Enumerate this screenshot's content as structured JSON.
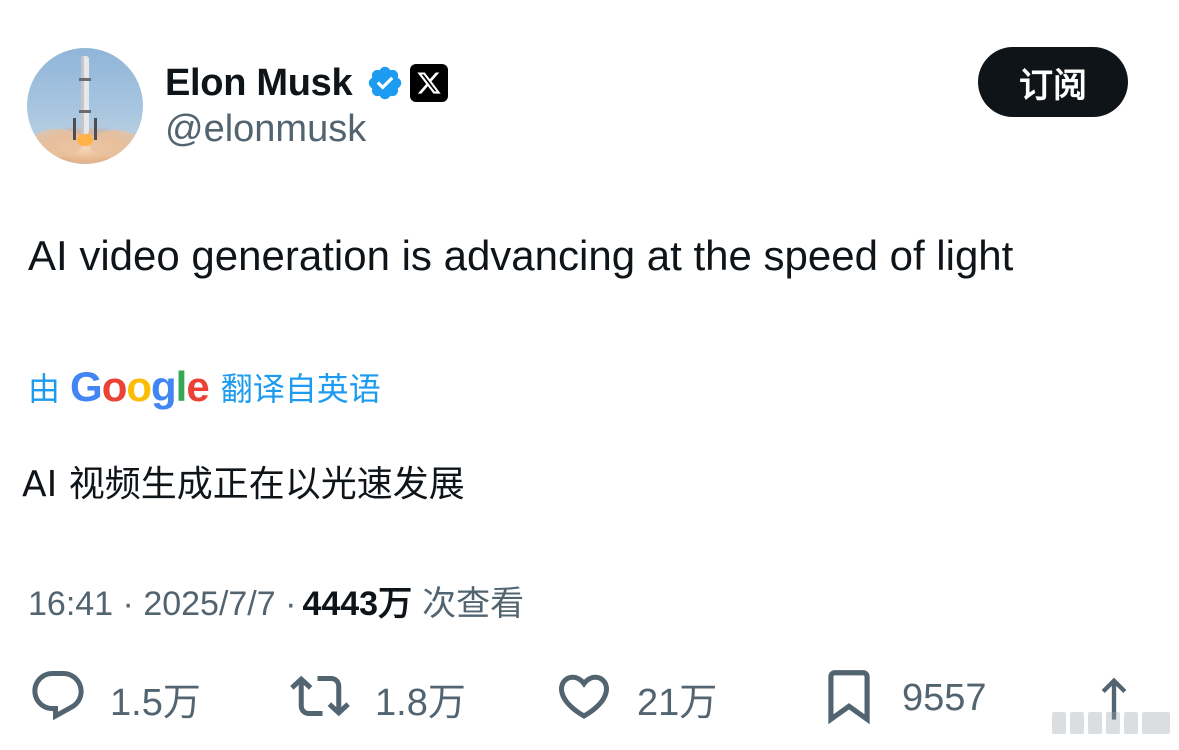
{
  "author": {
    "name": "Elon Musk",
    "handle": "@elonmusk",
    "avatar_icon": "rocket-launch-avatar",
    "verified_color": "#1d9bf0"
  },
  "subscribe_label": "订阅",
  "tweet": {
    "text": "AI video generation is advancing at the speed of light"
  },
  "translation": {
    "prefix": "由",
    "provider": [
      "G",
      "o",
      "o",
      "g",
      "l",
      "e"
    ],
    "suffix": "翻译自英语",
    "text": "AI 视频生成正在以光速发展"
  },
  "meta": {
    "time": "16:41",
    "date": "2025/7/7",
    "views": "4443万",
    "views_label": "次查看"
  },
  "actions": {
    "replies": "1.5万",
    "retweets": "1.8万",
    "likes": "21万",
    "bookmarks": "9557"
  },
  "colors": {
    "link": "#1d9bf0",
    "secondary": "#536471",
    "primary_text": "#0f1419"
  }
}
